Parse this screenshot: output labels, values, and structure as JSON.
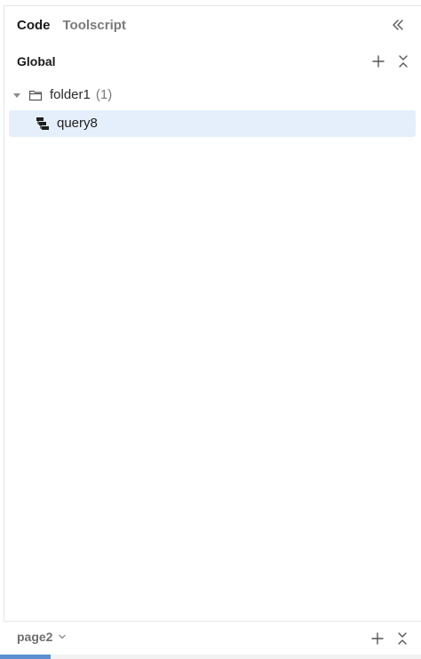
{
  "header": {
    "tabs": [
      {
        "label": "Code",
        "active": true
      },
      {
        "label": "Toolscript",
        "active": false
      }
    ],
    "collapse_icon": "double-chevron-left-icon"
  },
  "section": {
    "title": "Global",
    "add_icon": "plus-icon",
    "collapse_all_icon": "collapse-vertical-icon"
  },
  "tree": {
    "folder": {
      "label": "folder1",
      "count": "(1)",
      "icon": "folder-icon",
      "expanded": true
    },
    "query": {
      "label": "query8",
      "icon": "query-icon",
      "selected": true
    }
  },
  "footer": {
    "page_label": "page2",
    "add_icon": "plus-icon",
    "collapse_icon": "collapse-vertical-icon"
  },
  "progress": {
    "fraction": 0.12
  },
  "colors": {
    "selected_bg": "#e5effb",
    "progress": "#5b8fd1"
  }
}
